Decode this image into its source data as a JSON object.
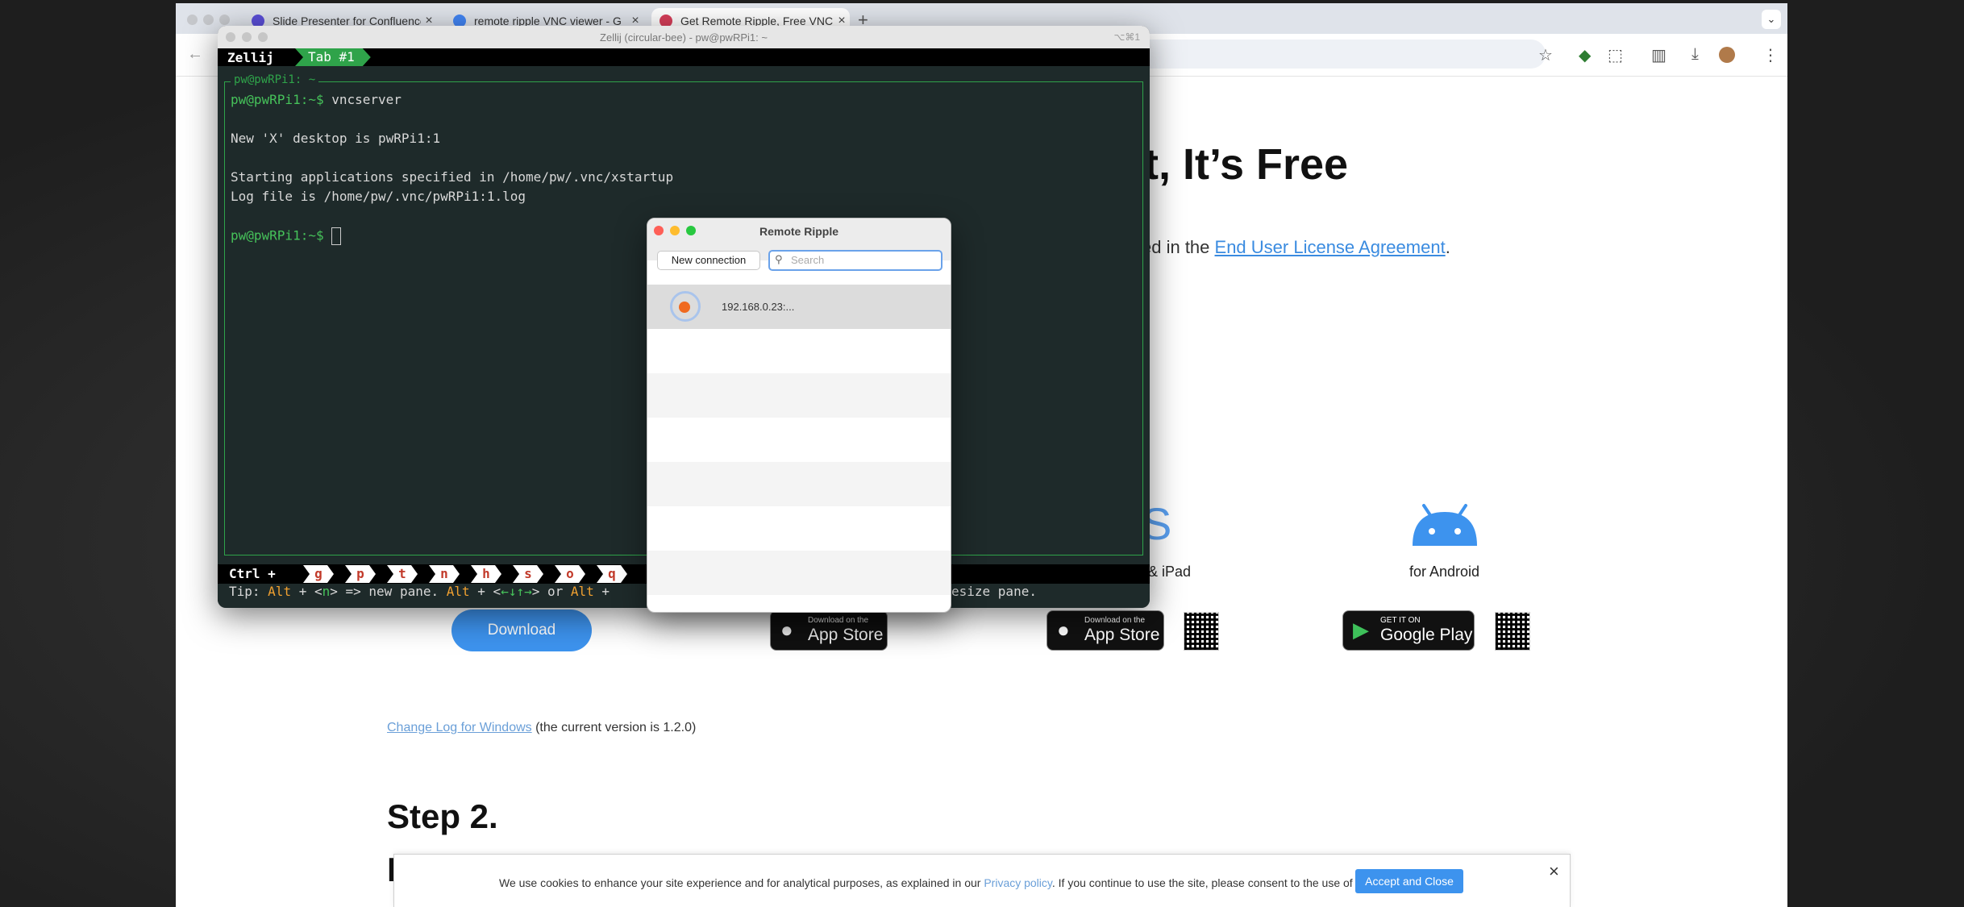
{
  "browser": {
    "tabs": [
      {
        "title": "Slide Presenter for Confluence",
        "favicon_color": "#5b4fd8"
      },
      {
        "title": "remote ripple VNC viewer - G",
        "favicon_color": "#4285f4"
      },
      {
        "title": "Get Remote Ripple, Free VNC",
        "favicon_color": "#d83f5a"
      }
    ],
    "new_tab": "+",
    "tab_close": "×"
  },
  "page": {
    "heading": "lt, It’s Free",
    "license_prefix": "ed in the ",
    "license_link": "End User License Agreement",
    "license_suffix": ".",
    "ios_text": "S",
    "ipad_label": "& iPad",
    "android_label": "for Android",
    "download_label": "Download",
    "appstore_small": "Download on the",
    "appstore_big": "App Store",
    "googleplay_small": "GET IT ON",
    "googleplay_big": "Google Play",
    "changelog_link": "Change Log for Windows",
    "changelog_text": " (the current version is 1.2.0)",
    "step2": "Step 2.",
    "step2_next": "I",
    "cookie": {
      "text_before": "We use cookies to enhance your site experience and for analytical purposes, as explained in our ",
      "link": "Privacy policy",
      "text_after": ". If you continue to use the site, please consent to the use of cookies.",
      "accept": "Accept and Close",
      "close": "×"
    }
  },
  "terminal": {
    "window_title": "Zellij (circular-bee) - pw@pwRPi1: ~",
    "shortcut": "⌥⌘1",
    "app": "Zellij",
    "tab": "Tab #1",
    "pane_title": "pw@pwRPi1: ~",
    "prompt": "pw@pwRPi1:~$",
    "lines": [
      " vncserver",
      "New 'X' desktop is pwRPi1:1",
      "Starting applications specified in /home/pw/.vnc/xstartup",
      "Log file is /home/pw/.vnc/pwRPi1:1.log"
    ],
    "status_ctrl": "Ctrl +",
    "keys": [
      "g",
      "p",
      "t",
      "n",
      "h",
      "s",
      "o",
      "q"
    ],
    "tip": {
      "label": "Tip: ",
      "alt1": "Alt",
      "plus1": " + <",
      "n": "n",
      "mid1": "> => new pane. ",
      "alt2": "Alt",
      "plus2": " + <",
      "arrows": "←↓↑→",
      "mid2": "> or ",
      "alt3": "Alt",
      "plus3": " +",
      "tail": "esize pane."
    }
  },
  "remote_ripple": {
    "title": "Remote Ripple",
    "new_connection": "New connection",
    "search_placeholder": "Search",
    "connections": [
      {
        "address": "192.168.0.23:..."
      }
    ]
  }
}
